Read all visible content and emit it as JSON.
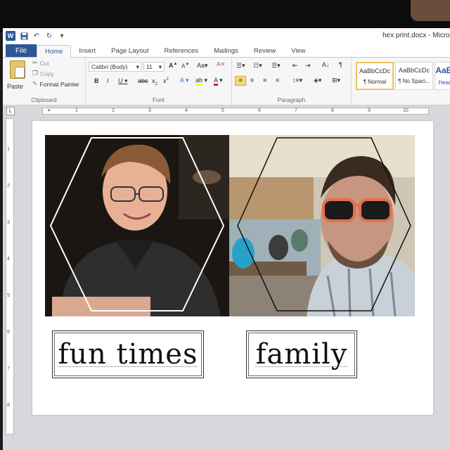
{
  "app": {
    "logo_letter": "W",
    "document_title": "hex print.docx - Micro"
  },
  "tabs": [
    {
      "label": "File"
    },
    {
      "label": "Home"
    },
    {
      "label": "Insert"
    },
    {
      "label": "Page Layout"
    },
    {
      "label": "References"
    },
    {
      "label": "Mailings"
    },
    {
      "label": "Review"
    },
    {
      "label": "View"
    }
  ],
  "ribbon": {
    "clipboard": {
      "label": "Clipboard",
      "paste": "Paste",
      "cut": "Cut",
      "copy": "Copy",
      "format_painter": "Format Painter"
    },
    "font": {
      "label": "Font",
      "font_name": "Calibri (Body)",
      "font_size": "11"
    },
    "paragraph": {
      "label": "Paragraph"
    },
    "styles": [
      {
        "sample": "AaBbCcDc",
        "name": "¶ Normal"
      },
      {
        "sample": "AaBbCcDc",
        "name": "¶ No Spaci..."
      },
      {
        "sample": "AaBl",
        "name": "Head"
      }
    ]
  },
  "ruler": {
    "numbers": [
      "1",
      "2",
      "3",
      "4",
      "5",
      "6",
      "7",
      "8",
      "9",
      "10"
    ],
    "vnumbers": [
      "1",
      "2",
      "3",
      "4",
      "5",
      "6",
      "7",
      "8"
    ]
  },
  "document": {
    "captions": [
      "fun times",
      "family"
    ]
  },
  "colors": {
    "word_blue": "#2b5797",
    "style_selected": "#f1c25a"
  }
}
